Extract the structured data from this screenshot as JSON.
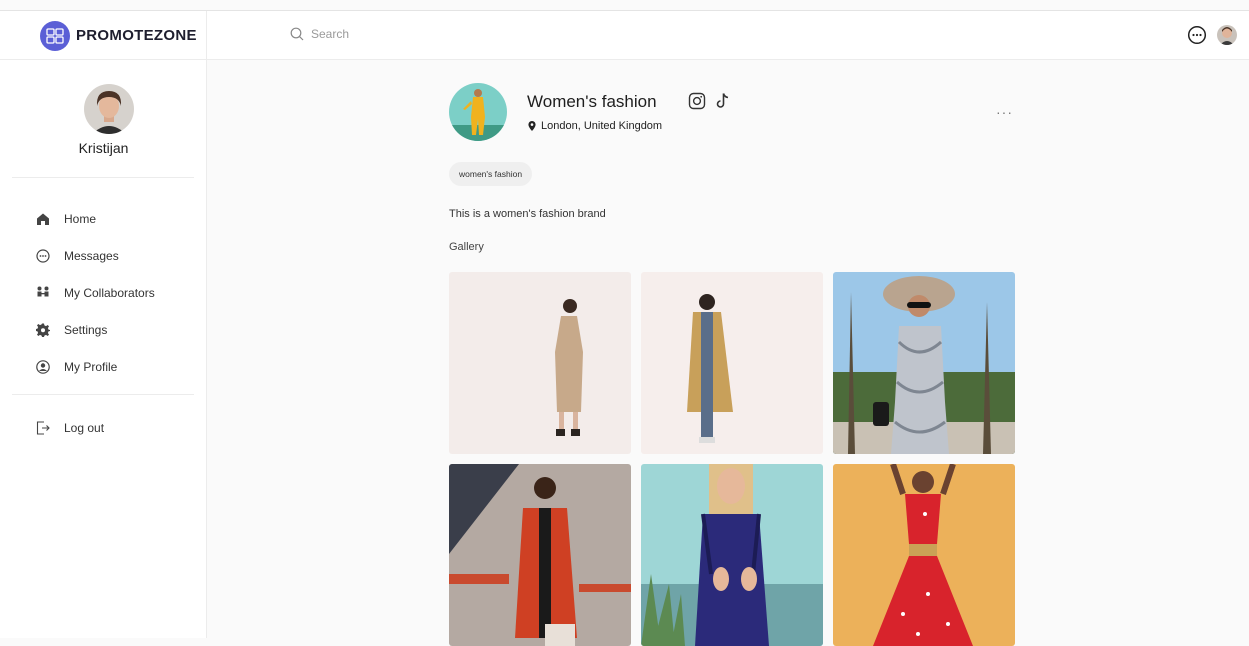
{
  "app": {
    "name": "PROMOTEZONE"
  },
  "search": {
    "placeholder": "Search"
  },
  "user": {
    "name": "Kristijan"
  },
  "nav": [
    {
      "label": "Home",
      "icon": "home-icon"
    },
    {
      "label": "Messages",
      "icon": "messages-icon"
    },
    {
      "label": "My Collaborators",
      "icon": "collaborators-icon"
    },
    {
      "label": "Settings",
      "icon": "gear-icon"
    },
    {
      "label": "My Profile",
      "icon": "profile-icon"
    }
  ],
  "logout": {
    "label": "Log out",
    "icon": "logout-icon"
  },
  "brand": {
    "title": "Women's fashion",
    "location": "London, United Kingdom",
    "tag": "women's fashion",
    "description": "This is a women's fashion brand",
    "gallery_label": "Gallery",
    "more": "···"
  },
  "colors": {
    "accent": "#5b5fd6",
    "tag_bg": "#efefef"
  }
}
